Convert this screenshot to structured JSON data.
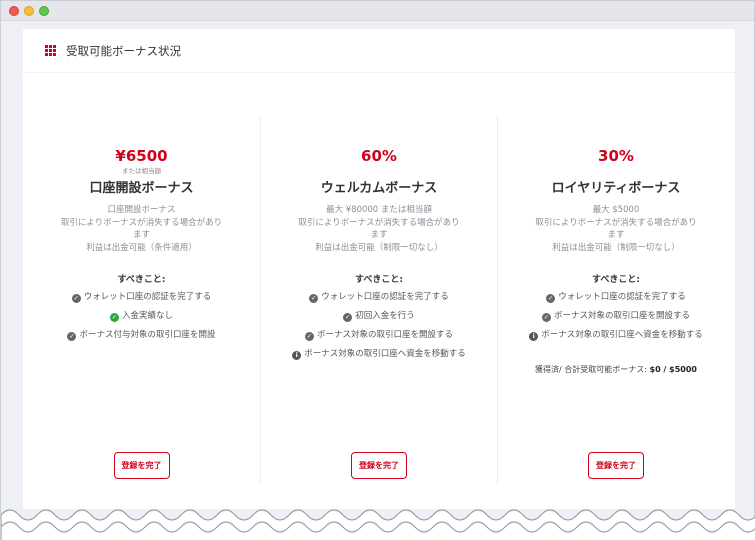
{
  "header": {
    "title": "受取可能ボーナス状況",
    "icon": "grid-icon"
  },
  "accent_color": "#d0021b",
  "bonuses": [
    {
      "amount": "¥6500",
      "equiv": "または相当額",
      "name": "口座開設ボーナス",
      "desc": [
        "口座開設ボーナス",
        "取引によりボーナスが消失する場合があり",
        "ます",
        "利益は出金可能（条件適用）"
      ],
      "todo_title": "すべきこと:",
      "todos": [
        {
          "icon": "check-circle-icon",
          "text": "ウォレット口座の認証を完了する"
        },
        {
          "icon": "check-circle-green-icon",
          "text": "入金実績なし"
        },
        {
          "icon": "check-circle-icon",
          "text": "ボーナス付与対象の取引口座を開設"
        }
      ],
      "button": "登録を完了"
    },
    {
      "amount": "60%",
      "equiv": "",
      "name": "ウェルカムボーナス",
      "desc": [
        "最大 ¥80000 または相当額",
        "取引によりボーナスが消失する場合があり",
        "ます",
        "利益は出金可能（制限一切なし）"
      ],
      "todo_title": "すべきこと:",
      "todos": [
        {
          "icon": "check-circle-icon",
          "text": "ウォレット口座の認証を完了する"
        },
        {
          "icon": "check-circle-icon",
          "text": "初回入金を行う"
        },
        {
          "icon": "check-circle-icon",
          "text": "ボーナス対象の取引口座を開設する"
        },
        {
          "icon": "info-circle-icon",
          "text": "ボーナス対象の取引口座へ資金を移動する"
        }
      ],
      "button": "登録を完了"
    },
    {
      "amount": "30%",
      "equiv": "",
      "name": "ロイヤリティボーナス",
      "desc": [
        "最大 $5000",
        "取引によりボーナスが消失する場合があり",
        "ます",
        "利益は出金可能（制限一切なし）"
      ],
      "todo_title": "すべきこと:",
      "todos": [
        {
          "icon": "check-circle-icon",
          "text": "ウォレット口座の認証を完了する"
        },
        {
          "icon": "check-circle-icon",
          "text": "ボーナス対象の取引口座を開設する"
        },
        {
          "icon": "info-circle-icon",
          "text": "ボーナス対象の取引口座へ資金を移動する"
        }
      ],
      "summary_label": "獲得済/ 合計受取可能ボーナス:",
      "summary_value": "$0 / $5000",
      "button": "登録を完了"
    }
  ]
}
